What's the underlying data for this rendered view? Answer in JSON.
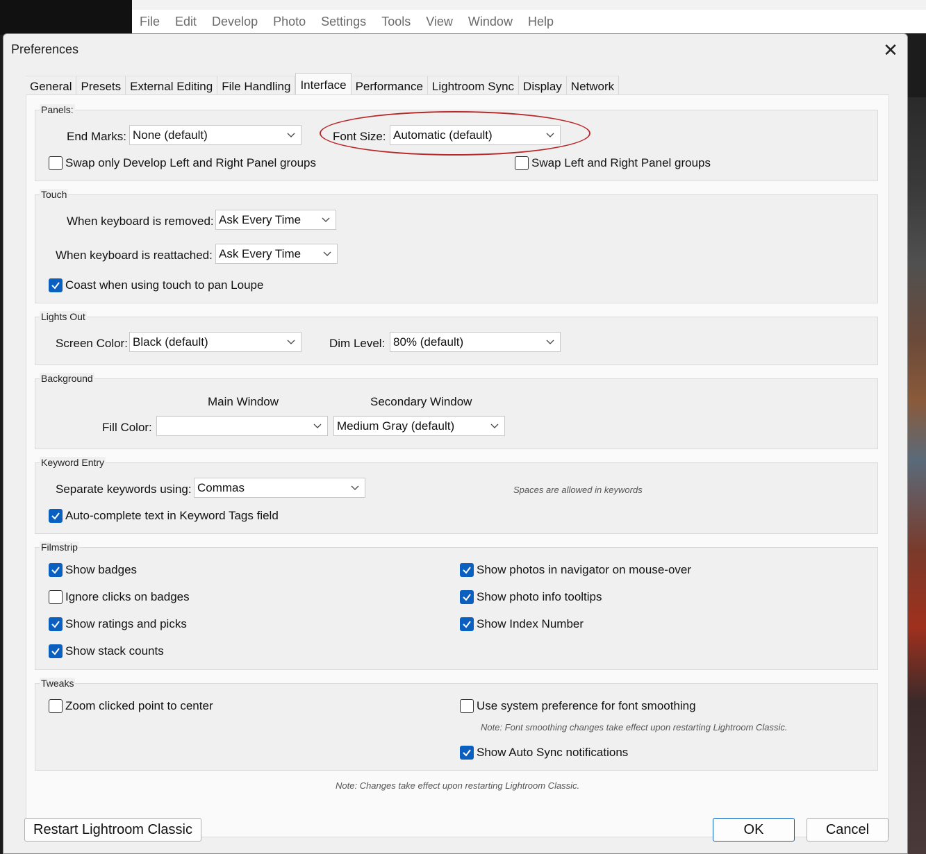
{
  "app_menu": [
    "File",
    "Edit",
    "Develop",
    "Photo",
    "Settings",
    "Tools",
    "View",
    "Window",
    "Help"
  ],
  "dialog": {
    "title": "Preferences",
    "close_glyph": "✕"
  },
  "tabs": [
    "General",
    "Presets",
    "External Editing",
    "File Handling",
    "Interface",
    "Performance",
    "Lightroom Sync",
    "Display",
    "Network"
  ],
  "active_tab": "Interface",
  "panels": {
    "label": "Panels:",
    "end_marks_label": "End Marks:",
    "end_marks_value": "None (default)",
    "font_size_label": "Font Size:",
    "font_size_value": "Automatic (default)",
    "swap_develop": "Swap only Develop Left and Right Panel groups",
    "swap_develop_checked": false,
    "swap_lr": "Swap Left and Right Panel groups",
    "swap_lr_checked": false
  },
  "touch": {
    "label": "Touch",
    "removed_label": "When keyboard is removed:",
    "removed_value": "Ask Every Time",
    "reattached_label": "When keyboard is reattached:",
    "reattached_value": "Ask Every Time",
    "coast": "Coast when using touch to pan Loupe",
    "coast_checked": true
  },
  "lights_out": {
    "label": "Lights Out",
    "screen_color_label": "Screen Color:",
    "screen_color_value": "Black (default)",
    "dim_level_label": "Dim Level:",
    "dim_level_value": "80% (default)"
  },
  "background": {
    "label": "Background",
    "main_window": "Main Window",
    "secondary_window": "Secondary Window",
    "fill_color_label": "Fill Color:",
    "main_value": "",
    "secondary_value": "Medium Gray (default)"
  },
  "keyword_entry": {
    "label": "Keyword Entry",
    "separate_label": "Separate keywords using:",
    "separate_value": "Commas",
    "spaces_note": "Spaces are allowed in keywords",
    "autocomplete": "Auto-complete text in Keyword Tags field",
    "autocomplete_checked": true
  },
  "filmstrip": {
    "label": "Filmstrip",
    "left": [
      {
        "text": "Show badges",
        "checked": true
      },
      {
        "text": "Ignore clicks on badges",
        "checked": false
      },
      {
        "text": "Show ratings and picks",
        "checked": true
      },
      {
        "text": "Show stack counts",
        "checked": true
      }
    ],
    "right": [
      {
        "text": "Show photos in navigator on mouse-over",
        "checked": true
      },
      {
        "text": "Show photo info tooltips",
        "checked": true
      },
      {
        "text": "Show Index Number",
        "checked": true
      }
    ]
  },
  "tweaks": {
    "label": "Tweaks",
    "zoom": "Zoom clicked point to center",
    "zoom_checked": false,
    "font_smoothing": "Use system preference for font smoothing",
    "font_smoothing_checked": false,
    "smoothing_note": "Note: Font smoothing changes take effect upon restarting Lightroom Classic.",
    "auto_sync": "Show Auto Sync notifications",
    "auto_sync_checked": true
  },
  "footer_note": "Note: Changes take effect upon restarting Lightroom Classic.",
  "buttons": {
    "restart": "Restart Lightroom Classic",
    "ok": "OK",
    "cancel": "Cancel"
  },
  "colors": {
    "accent": "#0b5fbe",
    "annotation": "#b8272a"
  }
}
